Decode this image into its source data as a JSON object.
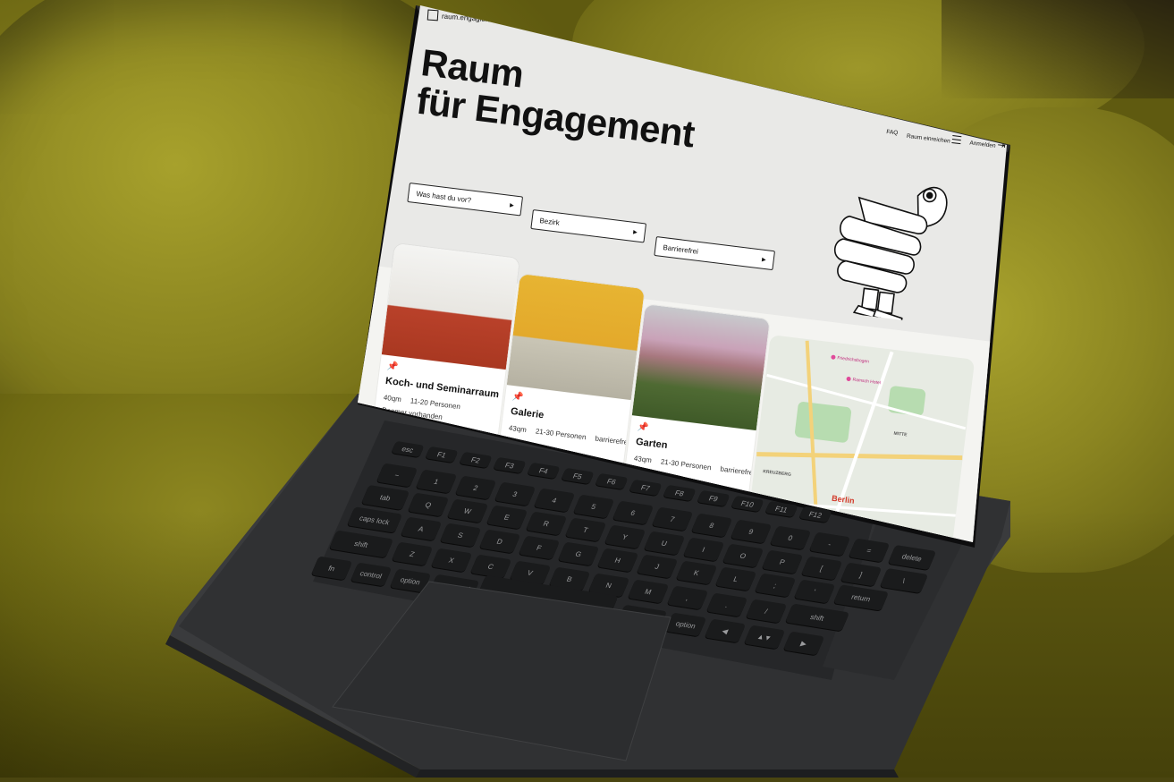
{
  "site": {
    "logo_text": "raum.engagiertes.berlin",
    "hero_title_line1": "Raum",
    "hero_title_line2": "für Engagement",
    "nav": {
      "faq": "FAQ",
      "submit_room": "Raum einreichen",
      "login": "Anmelden"
    },
    "filters": {
      "activity": "Was hast du vor?",
      "district": "Bezirk",
      "accessible": "Barrierefrei"
    },
    "cards": [
      {
        "title": "Koch- und Seminarraum",
        "size": "40qm",
        "capacity": "11-20 Personen",
        "extra": "Beamer vorhanden"
      },
      {
        "title": "Galerie",
        "size": "43qm",
        "capacity": "21-30 Personen",
        "extra": "barrierefrei"
      },
      {
        "title": "Garten",
        "size": "43qm",
        "capacity": "21-30 Personen",
        "extra": "barrierefrei"
      }
    ],
    "map": {
      "city": "Berlin",
      "poi_1": "Friedrichsbogen",
      "poi_2": "Ramsch Hotel",
      "label_1": "MITTE",
      "label_2": "KREUZBERG"
    }
  },
  "keyboard": {
    "keys_row1": [
      "esc",
      "F1",
      "F2",
      "F3",
      "F4",
      "F5",
      "F6",
      "F7",
      "F8",
      "F9",
      "F10",
      "F11",
      "F12"
    ],
    "keys_row2": [
      "~",
      "1",
      "2",
      "3",
      "4",
      "5",
      "6",
      "7",
      "8",
      "9",
      "0",
      "-",
      "=",
      "delete"
    ],
    "keys_row3": [
      "tab",
      "Q",
      "W",
      "E",
      "R",
      "T",
      "Y",
      "U",
      "I",
      "O",
      "P",
      "[",
      "]",
      "\\"
    ],
    "keys_row4": [
      "caps lock",
      "A",
      "S",
      "D",
      "F",
      "G",
      "H",
      "J",
      "K",
      "L",
      ";",
      "'",
      "return"
    ],
    "keys_row5": [
      "shift",
      "Z",
      "X",
      "C",
      "V",
      "B",
      "N",
      "M",
      ",",
      ".",
      "/",
      "shift"
    ],
    "keys_row6": [
      "fn",
      "control",
      "option",
      "command",
      "",
      "command",
      "option",
      "◀",
      "▲▼",
      "▶"
    ]
  }
}
